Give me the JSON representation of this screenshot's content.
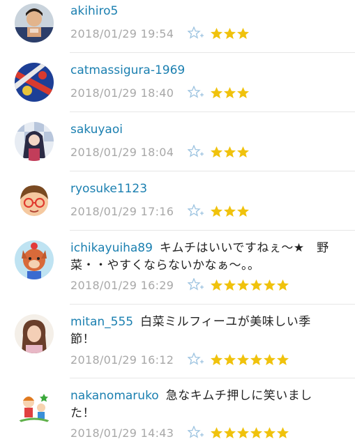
{
  "comments": [
    {
      "user": "akihiro5",
      "text": "",
      "date": "2018/01/29 19:54",
      "stars": 3,
      "avatar_icon": "anime-character-avatar-icon"
    },
    {
      "user": "catmassigura-1969",
      "text": "",
      "date": "2018/01/29 18:40",
      "stars": 3,
      "avatar_icon": "patterned-avatar-icon"
    },
    {
      "user": "sakuyaoi",
      "text": "",
      "date": "2018/01/29 18:04",
      "stars": 3,
      "avatar_icon": "anime-girl-avatar-icon"
    },
    {
      "user": "ryosuke1123",
      "text": "",
      "date": "2018/01/29 17:16",
      "stars": 3,
      "avatar_icon": "boy-with-glasses-avatar-icon"
    },
    {
      "user": "ichikayuiha89",
      "text_line1": "キムチはいいですねぇ～★　野",
      "text_line2": "菜・・やすくならないかなぁ～。。",
      "date": "2018/01/29 16:29",
      "stars": 6,
      "avatar_icon": "dog-character-avatar-icon"
    },
    {
      "user": "mitan_555",
      "text_line1": "白菜ミルフィーユが美味しい季",
      "text_line2": "節！",
      "date": "2018/01/29 16:12",
      "stars": 6,
      "avatar_icon": "woman-portrait-avatar-icon"
    },
    {
      "user": "nakanomaruko",
      "text_line1": "急なキムチ押しに笑いまし",
      "text_line2": "た！",
      "date": "2018/01/29 14:43",
      "stars": 6,
      "avatar_icon": "kids-illustration-avatar-icon"
    }
  ],
  "colors": {
    "username": "#1a7fb0",
    "star": "#f0c20c",
    "date": "#a8a8a8",
    "add_star": "#9cc3e0"
  },
  "icons": {
    "add_star": "add-star-icon",
    "star": "star-icon"
  }
}
